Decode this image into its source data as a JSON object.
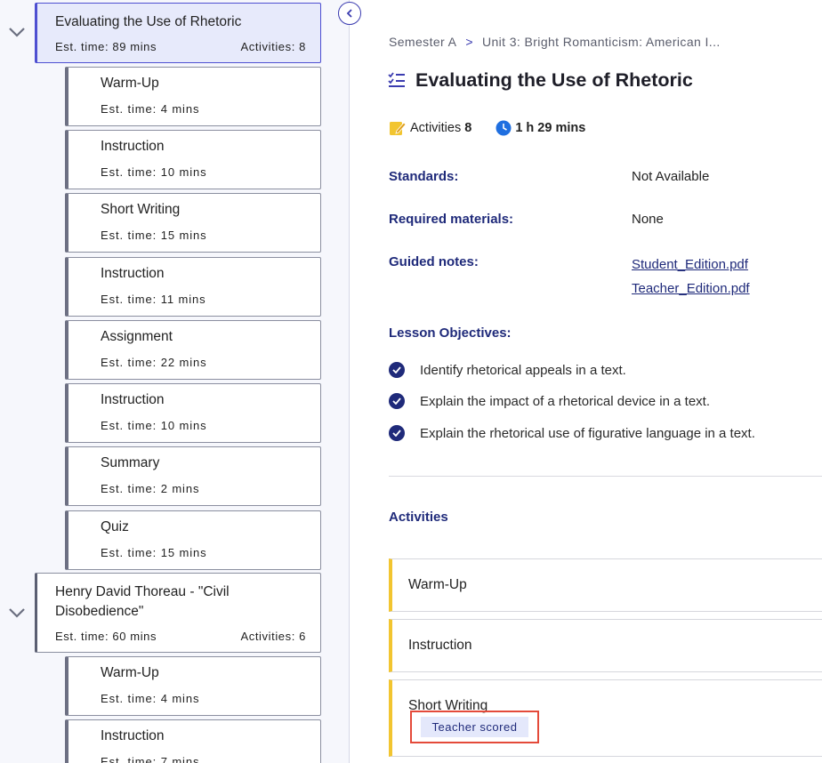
{
  "sidebar": {
    "lessons": [
      {
        "title": "Evaluating the Use of Rhetoric",
        "est_time": "Est. time: 89 mins",
        "activities": "Activities: 8"
      },
      {
        "title": "Henry David Thoreau - \"Civil Disobedience\"",
        "est_time": "Est. time: 60 mins",
        "activities": "Activities: 6"
      }
    ],
    "activities_1": [
      {
        "title": "Warm-Up",
        "time": "Est. time: 4 mins"
      },
      {
        "title": "Instruction",
        "time": "Est. time: 10 mins"
      },
      {
        "title": "Short Writing",
        "time": "Est. time: 15 mins"
      },
      {
        "title": "Instruction",
        "time": "Est. time: 11 mins"
      },
      {
        "title": "Assignment",
        "time": "Est. time: 22 mins"
      },
      {
        "title": "Instruction",
        "time": "Est. time: 10 mins"
      },
      {
        "title": "Summary",
        "time": "Est. time: 2 mins"
      },
      {
        "title": "Quiz",
        "time": "Est. time: 15 mins"
      }
    ],
    "activities_2": [
      {
        "title": "Warm-Up",
        "time": "Est. time: 4 mins"
      },
      {
        "title": "Instruction",
        "time": "Est. time: 7 mins"
      }
    ]
  },
  "breadcrumb": {
    "semester": "Semester A",
    "separator": ">",
    "unit": "Unit 3: Bright Romanticism: American I..."
  },
  "page": {
    "title": "Evaluating the Use of Rhetoric",
    "activities_label": "Activities",
    "activities_count": "8",
    "duration": "1 h 29 mins"
  },
  "details": {
    "standards_label": "Standards:",
    "standards_value": "Not Available",
    "materials_label": "Required materials:",
    "materials_value": "None",
    "notes_label": "Guided notes:",
    "notes_links": [
      "Student_Edition.pdf",
      "Teacher_Edition.pdf"
    ]
  },
  "objectives": {
    "label": "Lesson Objectives:",
    "items": [
      "Identify rhetorical appeals in a text.",
      "Explain the impact of a rhetorical device in a text.",
      "Explain the rhetorical use of figurative language in a text."
    ]
  },
  "activities": {
    "heading": "Activities",
    "cards": [
      {
        "title": "Warm-Up"
      },
      {
        "title": "Instruction"
      },
      {
        "title": "Short Writing",
        "badge": "Teacher scored"
      }
    ]
  },
  "colors": {
    "accent": "#1f2a7a",
    "active_border": "#4e4fd1",
    "card_accent": "#f2c530",
    "highlight": "#e44a3a"
  },
  "icons": [
    "chevron-down-icon",
    "chevron-left-icon",
    "checklist-icon",
    "pencil-note-icon",
    "clock-icon",
    "check-circle-icon"
  ]
}
